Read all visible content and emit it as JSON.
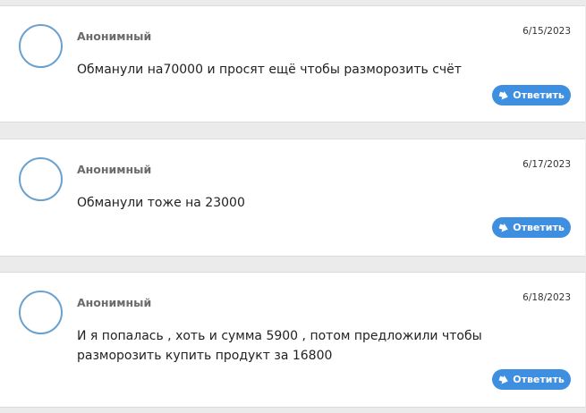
{
  "comments": [
    {
      "author": "Анонимный",
      "date": "6/15/2023",
      "text": "Обманули на70000 и просят ещё чтобы разморозить счёт",
      "reply_label": "Ответить"
    },
    {
      "author": "Анонимный",
      "date": "6/17/2023",
      "text": "Обманули тоже на 23000",
      "reply_label": "Ответить"
    },
    {
      "author": "Анонимный",
      "date": "6/18/2023",
      "text": "И я попалась , хоть и сумма 5900 , потом предложили чтобы разморозить купить продукт за 16800",
      "reply_label": "Ответить"
    }
  ],
  "icons": {
    "avatar": "user-avatar-circle",
    "reply": "reply-arrow-icon"
  },
  "colors": {
    "accent": "#3f8fe0",
    "avatar_ring": "#6aa1cf",
    "background": "#ebebeb"
  }
}
